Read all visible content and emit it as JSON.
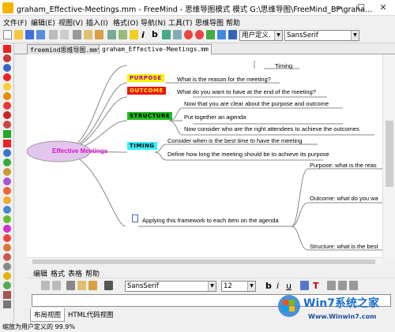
{
  "window": {
    "title": "graham_Effective-Meetings.mm - FreeMind - 思维导图模式 模式 G:\\思维导图\\FreeMind_BP\\graha...",
    "minimize": "—",
    "maximize": "☐",
    "close": "✕"
  },
  "menu": [
    "文件(F)",
    "编辑(E)",
    "视图(V)",
    "插入(I)",
    "格式(O)",
    "导航(N)",
    "工具(T)",
    "思维导图",
    "帮助"
  ],
  "toolbar": {
    "zoom_value": "用户定义.",
    "font_value": "SansSerif",
    "italic": "i",
    "bold": "b"
  },
  "tabs": [
    "freemind思维导图.mm*",
    "graham_Effective-Meetings.mm"
  ],
  "mindmap": {
    "root": "Effective Meetings",
    "timing_top": "Timing",
    "purpose_tag": "PURPOSE",
    "purpose_text": "What is the reason for the meeting?",
    "outcome_tag": "OUTCOME",
    "outcome_text": "What do you want to have at the end of the meeting?",
    "structure_tag": "STRUCTURE",
    "structure_items": [
      "Now that you are clear about the purpose and outcome",
      "Put together an agenda",
      "Now consider who are the right attendees to achieve the outcomes"
    ],
    "timing_tag": "TIMING",
    "timing_items": [
      "Consider when is the best time to have the meeting",
      "Define how long the meeting should be to achieve its purpose"
    ],
    "apply_text": "Applying this framework to each item on the agenda",
    "right_items": [
      "Purpose: what is the reas",
      "Outcome: what do you wa",
      "Structure: what is the best"
    ]
  },
  "editor": {
    "menu": [
      "编辑",
      "格式",
      "表格",
      "帮助"
    ],
    "font": "SansSerif",
    "size": "12",
    "bold": "b",
    "italic": "i",
    "underline": "u",
    "text": "T"
  },
  "bottom_tabs": [
    "布局视图",
    "HTML代码视图"
  ],
  "status": "缩放为用户定义的 99.9%",
  "watermark": {
    "brand": "Win7系统之家",
    "url": "Www.Winwin7.com"
  },
  "colors": {
    "root_fill": "#e3c6ee",
    "root_text": "#d416c8",
    "purpose": "#f5f500",
    "outcome": "#ee1111",
    "structure": "#22bb22",
    "timing": "#33f0ff",
    "edge": "#888888"
  }
}
